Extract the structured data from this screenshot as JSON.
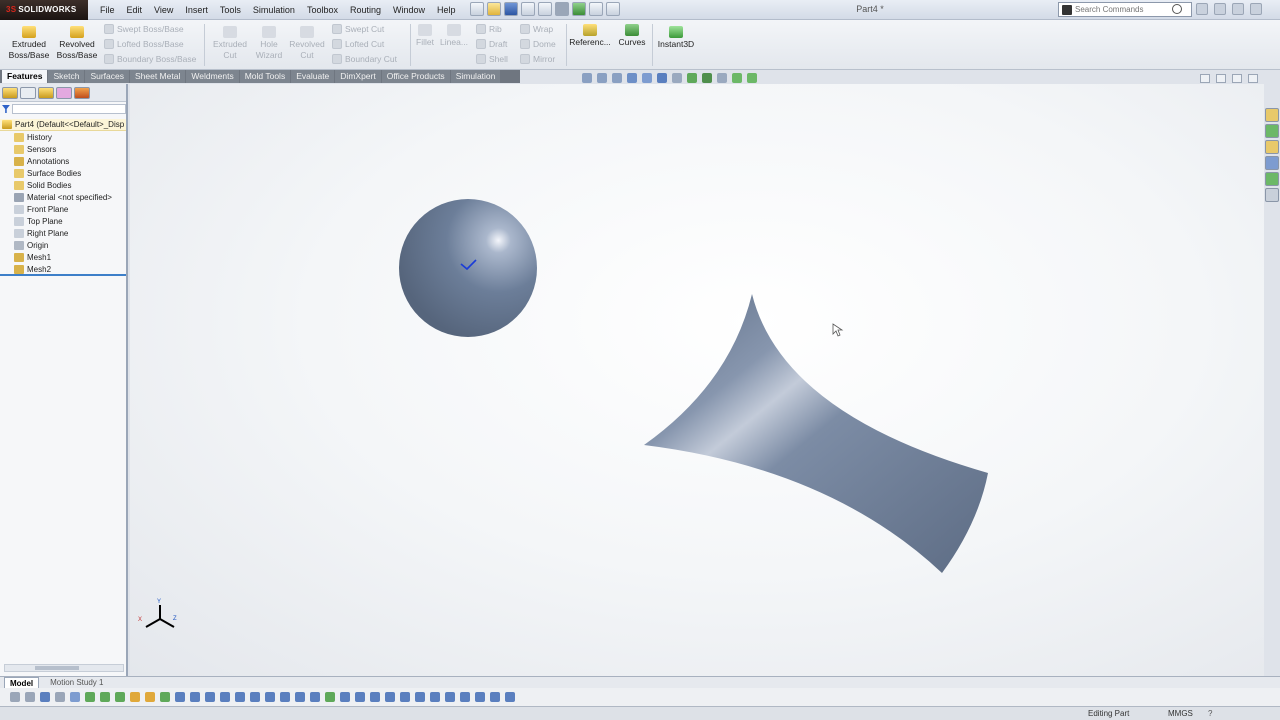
{
  "app": {
    "brand": "SOLIDWORKS",
    "brand_prefix": "3S",
    "document_title": "Part4 *"
  },
  "menu": [
    "File",
    "Edit",
    "View",
    "Insert",
    "Tools",
    "Simulation",
    "Toolbox",
    "Routing",
    "Window",
    "Help"
  ],
  "search": {
    "placeholder": "Search Commands"
  },
  "ribbon": {
    "extruded_boss": "Extruded Boss/Base",
    "revolved_boss": "Revolved Boss/Base",
    "swept_boss": "Swept Boss/Base",
    "lofted_boss": "Lofted Boss/Base",
    "boundary_boss": "Boundary Boss/Base",
    "extruded_cut": "Extruded Cut",
    "hole_wizard": "Hole Wizard",
    "revolved_cut": "Revolved Cut",
    "swept_cut": "Swept Cut",
    "lofted_cut": "Lofted Cut",
    "boundary_cut": "Boundary Cut",
    "fillet": "Fillet",
    "linear_pattern": "Linea...",
    "rib": "Rib",
    "draft": "Draft",
    "shell": "Shell",
    "wrap": "Wrap",
    "dome": "Dome",
    "mirror": "Mirror",
    "reference": "Referenc...",
    "curves": "Curves",
    "instant3d": "Instant3D"
  },
  "tabs": [
    "Features",
    "Sketch",
    "Surfaces",
    "Sheet Metal",
    "Weldments",
    "Mold Tools",
    "Evaluate",
    "DimXpert",
    "Office Products",
    "Simulation"
  ],
  "tree": {
    "root": "Part4  (Default<<Default>_Disp",
    "items": [
      "History",
      "Sensors",
      "Annotations",
      "Surface Bodies",
      "Solid Bodies",
      "Material <not specified>",
      "Front Plane",
      "Top Plane",
      "Right Plane",
      "Origin",
      "Mesh1",
      "Mesh2"
    ]
  },
  "bottom_tabs": [
    "Model",
    "Motion Study 1"
  ],
  "status": {
    "mode": "Editing Part",
    "units": "MMGS",
    "help": "? "
  },
  "colors": {
    "accent": "#3d7fc9",
    "model_fill": "#6b7f9e",
    "brand_red": "#d9261c"
  }
}
